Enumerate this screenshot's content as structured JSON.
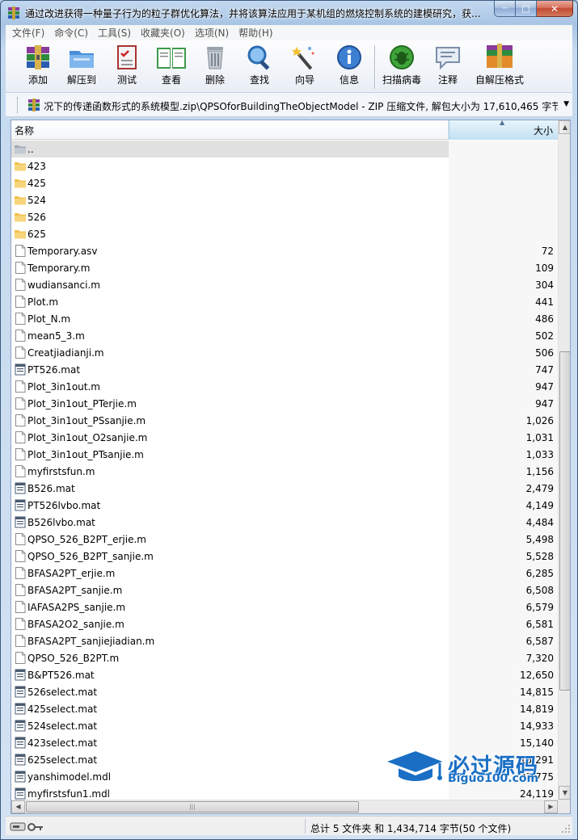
{
  "window": {
    "title": "通过改进获得一种量子行为的粒子群优化算法，并将该算法应用于某机组的燃烧控制系统的建模研究，获...",
    "controls": {
      "minimize": "─",
      "maximize": "□",
      "close": "✕"
    }
  },
  "menu": [
    "文件(F)",
    "命令(C)",
    "工具(S)",
    "收藏夹(O)",
    "选项(N)",
    "帮助(H)"
  ],
  "toolbar": [
    {
      "label": "添加",
      "icon": "add-archive-icon"
    },
    {
      "label": "解压到",
      "icon": "extract-to-icon"
    },
    {
      "label": "测试",
      "icon": "test-icon"
    },
    {
      "label": "查看",
      "icon": "view-icon"
    },
    {
      "label": "删除",
      "icon": "delete-icon"
    },
    {
      "label": "查找",
      "icon": "find-icon"
    },
    {
      "label": "向导",
      "icon": "wizard-icon"
    },
    {
      "label": "信息",
      "icon": "info-icon"
    },
    {
      "label": "扫描病毒",
      "icon": "virus-scan-icon"
    },
    {
      "label": "注释",
      "icon": "comment-icon"
    },
    {
      "label": "自解压格式",
      "icon": "sfx-icon"
    }
  ],
  "address": {
    "path": "况下的传递函数形式的系统模型.zip\\QPSOforBuildingTheObjectModel - ZIP 压缩文件, 解包大小为 17,610,465 字节"
  },
  "columns": {
    "name": "名称",
    "size": "大小"
  },
  "files": [
    {
      "name": "..",
      "size": "",
      "type": "parent"
    },
    {
      "name": "423",
      "size": "",
      "type": "folder"
    },
    {
      "name": "425",
      "size": "",
      "type": "folder"
    },
    {
      "name": "524",
      "size": "",
      "type": "folder"
    },
    {
      "name": "526",
      "size": "",
      "type": "folder"
    },
    {
      "name": "625",
      "size": "",
      "type": "folder"
    },
    {
      "name": "Temporary.asv",
      "size": "72",
      "type": "file"
    },
    {
      "name": "Temporary.m",
      "size": "109",
      "type": "file"
    },
    {
      "name": "wudiansanci.m",
      "size": "304",
      "type": "file"
    },
    {
      "name": "Plot.m",
      "size": "441",
      "type": "file"
    },
    {
      "name": "Plot_N.m",
      "size": "486",
      "type": "file"
    },
    {
      "name": "mean5_3.m",
      "size": "502",
      "type": "file"
    },
    {
      "name": "Creatjiadianji.m",
      "size": "506",
      "type": "file"
    },
    {
      "name": "PT526.mat",
      "size": "747",
      "type": "mat"
    },
    {
      "name": "Plot_3in1out.m",
      "size": "947",
      "type": "file"
    },
    {
      "name": "Plot_3in1out_PTerjie.m",
      "size": "947",
      "type": "file"
    },
    {
      "name": "Plot_3in1out_PSsanjie.m",
      "size": "1,026",
      "type": "file"
    },
    {
      "name": "Plot_3in1out_O2sanjie.m",
      "size": "1,031",
      "type": "file"
    },
    {
      "name": "Plot_3in1out_PTsanjie.m",
      "size": "1,033",
      "type": "file"
    },
    {
      "name": "myfirstsfun.m",
      "size": "1,156",
      "type": "file"
    },
    {
      "name": "B526.mat",
      "size": "2,479",
      "type": "mat"
    },
    {
      "name": "PT526lvbo.mat",
      "size": "4,149",
      "type": "mat"
    },
    {
      "name": "B526lvbo.mat",
      "size": "4,484",
      "type": "mat"
    },
    {
      "name": "QPSO_526_B2PT_erjie.m",
      "size": "5,498",
      "type": "file"
    },
    {
      "name": "QPSO_526_B2PT_sanjie.m",
      "size": "5,528",
      "type": "file"
    },
    {
      "name": "BFASA2PT_erjie.m",
      "size": "6,285",
      "type": "file"
    },
    {
      "name": "BFASA2PT_sanjie.m",
      "size": "6,508",
      "type": "file"
    },
    {
      "name": "IAFASA2PS_sanjie.m",
      "size": "6,579",
      "type": "file"
    },
    {
      "name": "BFASA2O2_sanjie.m",
      "size": "6,581",
      "type": "file"
    },
    {
      "name": "BFASA2PT_sanjiejiadian.m",
      "size": "6,587",
      "type": "file"
    },
    {
      "name": "QPSO_526_B2PT.m",
      "size": "7,320",
      "type": "file"
    },
    {
      "name": "B&PT526.mat",
      "size": "12,650",
      "type": "mat"
    },
    {
      "name": "526select.mat",
      "size": "14,815",
      "type": "mat"
    },
    {
      "name": "425select.mat",
      "size": "14,819",
      "type": "mat"
    },
    {
      "name": "524select.mat",
      "size": "14,933",
      "type": "mat"
    },
    {
      "name": "423select.mat",
      "size": "15,140",
      "type": "mat"
    },
    {
      "name": "625select.mat",
      "size": "15,291",
      "type": "mat"
    },
    {
      "name": "yanshimodel.mdl",
      "size": "23,775",
      "type": "mat"
    },
    {
      "name": "myfirstsfun1.mdl",
      "size": "24,119",
      "type": "mat"
    }
  ],
  "status": {
    "summary": "总计 5 文件夹 和 1,434,714 字节(50 个文件)"
  },
  "watermark": {
    "cn": "必过源码",
    "en": "Biguo100.com"
  },
  "colors": {
    "folder": "#f2c14e",
    "accent": "#1a6fc4",
    "selection": "#e0e0e0"
  }
}
